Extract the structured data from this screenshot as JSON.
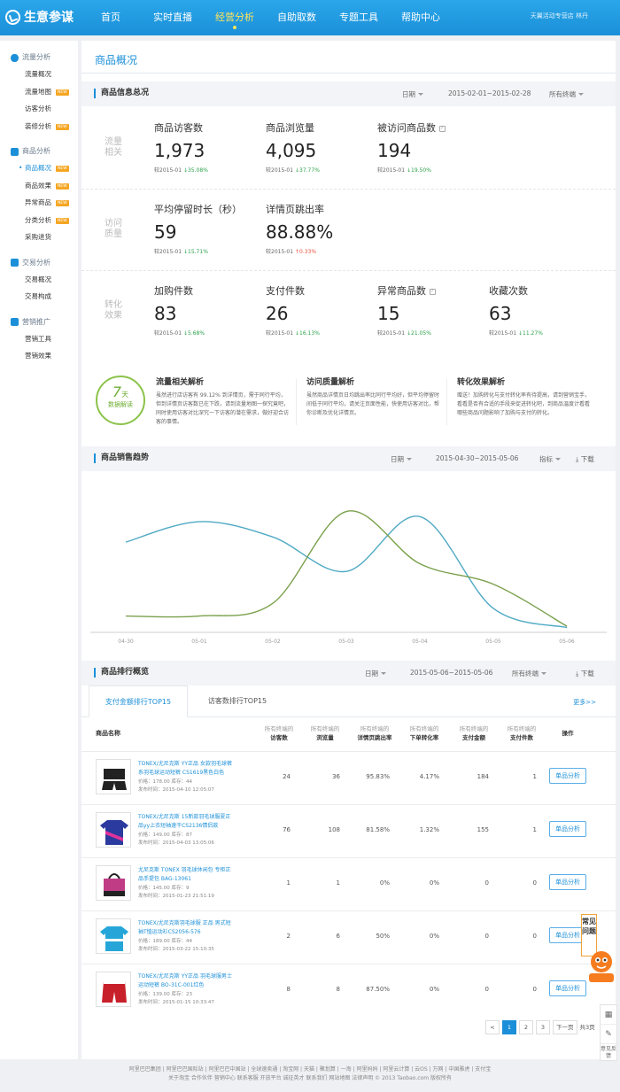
{
  "app": {
    "title": "生意参谋",
    "shop": "天翼活动专营店  林丹"
  },
  "nav": [
    {
      "label": "首页",
      "active": false
    },
    {
      "label": "实时直播",
      "active": false
    },
    {
      "label": "经营分析",
      "active": true
    },
    {
      "label": "自助取数",
      "active": false
    },
    {
      "label": "专题工具",
      "active": false
    },
    {
      "label": "帮助中心",
      "active": false
    }
  ],
  "sidebar": [
    {
      "title": "流量分析",
      "icon": "eye-icon",
      "items": [
        {
          "label": "流量概况",
          "new": false
        },
        {
          "label": "流量地图",
          "new": true
        },
        {
          "label": "访客分析",
          "new": false
        },
        {
          "label": "装修分析",
          "new": true
        }
      ]
    },
    {
      "title": "商品分析",
      "icon": "box-icon",
      "items": [
        {
          "label": "商品概况",
          "new": true,
          "active": true
        },
        {
          "label": "商品效果",
          "new": true
        },
        {
          "label": "异常商品",
          "new": true
        },
        {
          "label": "分类分析",
          "new": true
        },
        {
          "label": "采购进货",
          "new": false
        }
      ]
    },
    {
      "title": "交易分析",
      "icon": "cart-icon",
      "items": [
        {
          "label": "交易概况",
          "new": false
        },
        {
          "label": "交易构成",
          "new": false
        }
      ]
    },
    {
      "title": "营销推广",
      "icon": "megaphone-icon",
      "items": [
        {
          "label": "营销工具",
          "new": false
        },
        {
          "label": "营销效果",
          "new": false
        }
      ]
    }
  ],
  "new_tag": "NEW",
  "page_title": "商品概况",
  "summary": {
    "title": "商品信息总况",
    "date_label": "日期",
    "date_range": "2015-02-01~2015-02-28",
    "terminal": "所有终端",
    "rows": [
      {
        "label": "流量相关",
        "metrics": [
          {
            "label": "商品访客数",
            "value": "1,973",
            "cmp": "较2015-01",
            "dir": "down",
            "pct": "35.08%",
            "q": false
          },
          {
            "label": "商品浏览量",
            "value": "4,095",
            "cmp": "较2015-01",
            "dir": "down",
            "pct": "37.77%",
            "q": false
          },
          {
            "label": "被访问商品数",
            "value": "194",
            "cmp": "较2015-01",
            "dir": "down",
            "pct": "19.50%",
            "q": true
          }
        ]
      },
      {
        "label": "访问质量",
        "metrics": [
          {
            "label": "平均停留时长（秒）",
            "value": "59",
            "cmp": "较2015-01",
            "dir": "down",
            "pct": "15.71%",
            "q": false
          },
          {
            "label": "详情页跳出率",
            "value": "88.88%",
            "cmp": "较2015-01",
            "dir": "up",
            "pct": "0.33%",
            "q": false
          }
        ]
      },
      {
        "label": "转化效果",
        "metrics": [
          {
            "label": "加购件数",
            "value": "83",
            "cmp": "较2015-01",
            "dir": "down",
            "pct": "5.68%",
            "q": false
          },
          {
            "label": "支付件数",
            "value": "26",
            "cmp": "较2015-01",
            "dir": "down",
            "pct": "16.13%",
            "q": false
          },
          {
            "label": "异常商品数",
            "value": "15",
            "cmp": "较2015-01",
            "dir": "down",
            "pct": "21.05%",
            "q": true
          },
          {
            "label": "收藏次数",
            "value": "63",
            "cmp": "较2015-01",
            "dir": "down",
            "pct": "11.27%",
            "q": false
          }
        ]
      }
    ]
  },
  "insight": {
    "badge_number": "7",
    "badge_unit": "天",
    "badge_label": "数据解读",
    "cols": [
      {
        "title": "流量相关解析",
        "text": "虽然进行店访客有 99.12% 到详情页，需于同行平均，但到详情页访客数已在下跌，请到流量地图一探究竟吧，同时使用访客对比深究一下访客的潜在需求，做好迎合访客的事情。"
      },
      {
        "title": "访问质量解析",
        "text": "虽然商品详情页日均跳出率比同行平均好，但平均停留时间低于同行平均，请关注页面性能，快使用访客对比，帮你诊断及优化详情页。"
      },
      {
        "title": "转化效果解析",
        "text": "赠送！加购转化与支付转化率有待提高，请到营销宝手，看看是否有合适的手段来促进转化吧，到商品温度计看看哪些商品问题影响了加购与支付的转化。"
      }
    ]
  },
  "trend": {
    "title": "商品销售趋势",
    "date_label": "日期",
    "date_range": "2015-04-30~2015-05-06",
    "indicator": "指标",
    "download": "下载"
  },
  "chart_data": {
    "type": "line",
    "x": [
      "04-30",
      "05-01",
      "05-02",
      "05-03",
      "05-04",
      "05-05",
      "05-06"
    ],
    "xlabel": "",
    "ylabel": "",
    "grid": false,
    "series": [
      {
        "color": "#4fa9c4",
        "values": [
          0.68,
          0.84,
          0.72,
          0.45,
          0.88,
          0.16,
          0.01
        ]
      },
      {
        "color": "#7aa04c",
        "values": [
          0.1,
          0.1,
          0.2,
          0.92,
          0.51,
          0.35,
          0.02
        ]
      }
    ]
  },
  "ranking": {
    "title": "商品排行概览",
    "date_label": "日期",
    "date_range": "2015-05-06~2015-05-06",
    "terminal": "所有终端",
    "download": "下载",
    "tabs": [
      "支付金额排行TOP15",
      "访客数排行TOP15"
    ],
    "more": "更多>>",
    "headers": {
      "name": "商品名称",
      "prefix": "所有终端的",
      "cols": [
        "访客数",
        "浏览量",
        "详情页跳出率",
        "下单转化率",
        "支付金额",
        "支付件数"
      ],
      "action": "操作"
    },
    "rows": [
      {
        "name": "TONEX/尤尼克斯 YY正品 女款羽毛球裤系羽毛球运动短裤 CS1619黑色白色",
        "price": "价格：178.00",
        "stock": "库存：44",
        "date": "发布时间：2015-04-10 12:05:07",
        "vals": [
          "24",
          "36",
          "95.83%",
          "4.17%",
          "184",
          "1"
        ]
      },
      {
        "name": "TONEX/尤尼克斯 15新款羽毛球服夏正品yy上衣短袖速干CS2136情侣款",
        "price": "价格：149.00",
        "stock": "库存：87",
        "date": "发布时间：2015-04-03 13:05:06",
        "vals": [
          "76",
          "108",
          "81.58%",
          "1.32%",
          "155",
          "1"
        ]
      },
      {
        "name": "尤尼克斯 TONEX 羽毛球休闲包 专柜正品手提包 BAG-13061",
        "price": "价格：145.00",
        "stock": "库存：9",
        "date": "发布时间：2015-01-23 21:51:19",
        "vals": [
          "1",
          "1",
          "0%",
          "0%",
          "0",
          "0"
        ]
      },
      {
        "name": "TONEX/尤尼克斯羽毛球服 正品 男式短袖T恤运动衫CS2056-576",
        "price": "价格：189.00",
        "stock": "库存：44",
        "date": "发布时间：2015-03-22 15:10:35",
        "vals": [
          "2",
          "6",
          "50%",
          "0%",
          "0",
          "0"
        ]
      },
      {
        "name": "TONEX/尤尼克斯 YY正品 羽毛球服男士运动短裤 BO-31C-001红色",
        "price": "价格：139.00",
        "stock": "库存：23",
        "date": "发布时间：2015-01-15 10:33:47",
        "vals": [
          "8",
          "8",
          "87.50%",
          "0%",
          "0",
          "0"
        ]
      }
    ],
    "action_label": "单品分析"
  },
  "pager": {
    "prev": "<",
    "pages": [
      "1",
      "2",
      "3"
    ],
    "next": "下一页",
    "total": "共3页"
  },
  "float_help": "常见问题",
  "feedback": "意见反馈",
  "footer": {
    "line1": "阿里巴巴集团 | 阿里巴巴国际站 | 阿里巴巴中国站 | 全球速卖通 | 淘宝网 | 天猫 | 聚划算 | 一淘 | 阿里妈妈 | 阿里云计算 | 云OS | 万网 | 中国雅虎 | 支付宝",
    "line2": "关于淘宝 合作伙伴 营销中心 联系客服 开放平台 诚征英才 联系我们 网站地图 法律声明 © 2013 Taobao.com 版权所有"
  }
}
